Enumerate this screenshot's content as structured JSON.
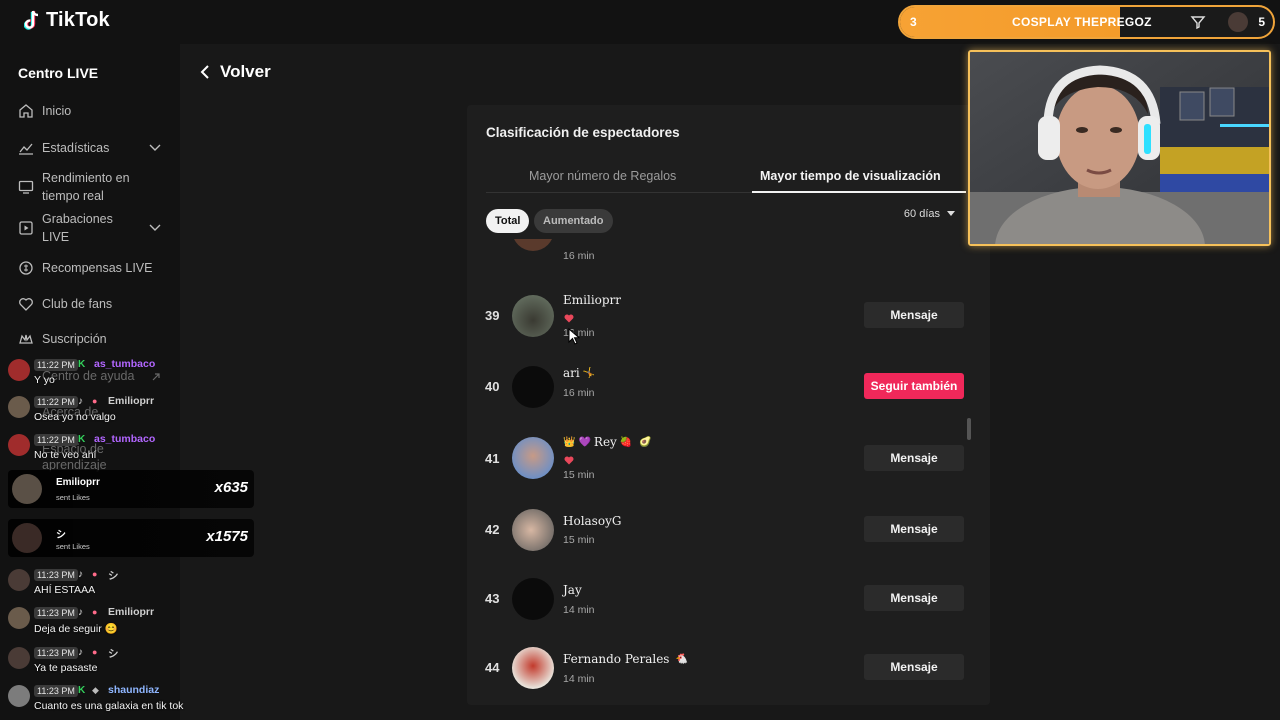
{
  "app": {
    "logo_text": "TikTok"
  },
  "goal": {
    "start": "3",
    "label": "COSPLAY THEPREGOZ",
    "end": "5",
    "progress": 0.59
  },
  "sidebar": {
    "title": "Centro LIVE",
    "items": [
      {
        "label": "Inicio",
        "icon": "home-icon"
      },
      {
        "label": "Estadísticas",
        "icon": "chart-icon"
      },
      {
        "label": "Rendimiento en tiempo real",
        "icon": "monitor-icon"
      },
      {
        "label": "Grabaciones LIVE",
        "icon": "recording-icon"
      },
      {
        "label": "Recompensas LIVE",
        "icon": "rewards-icon"
      },
      {
        "label": "Club de fans",
        "icon": "fans-icon"
      },
      {
        "label": "Suscripción",
        "icon": "subscription-icon"
      },
      {
        "label": "Centro de ayuda",
        "icon": "help-icon"
      },
      {
        "label": "Acerca de",
        "icon": "info-icon"
      },
      {
        "label": "Espacio de aprendizaje",
        "icon": "learn-icon"
      }
    ]
  },
  "main": {
    "back_label": "Volver",
    "panel_title": "Clasificación de espectadores",
    "tabs": [
      "Mayor número de Regalos",
      "Mayor tiempo de visualización"
    ],
    "filters": [
      "Total",
      "Aumentado"
    ],
    "period": "60 días",
    "partial_row": {
      "minutes": "16 min"
    },
    "rows": [
      {
        "rank": "39",
        "name": "Emilioprr",
        "heart": true,
        "minutes": "16 min",
        "action": "Mensaje"
      },
      {
        "rank": "40",
        "name": "ari",
        "heart": false,
        "minutes": "16 min",
        "action": "Seguir también"
      },
      {
        "rank": "41",
        "name": "Rey",
        "heart": true,
        "minutes": "15 min",
        "action": "Mensaje"
      },
      {
        "rank": "42",
        "name": "HolasoyG",
        "heart": false,
        "minutes": "15 min",
        "action": "Mensaje"
      },
      {
        "rank": "43",
        "name": "Jay",
        "heart": false,
        "minutes": "14 min",
        "action": "Mensaje"
      },
      {
        "rank": "44",
        "name": "Fernando Perales",
        "heart": false,
        "minutes": "14 min",
        "action": "Mensaje"
      }
    ]
  },
  "chat": {
    "messages": [
      {
        "time": "11:22 PM",
        "user": "as_tumbaco",
        "text": "Y yo"
      },
      {
        "time": "11:22 PM",
        "user": "Emilioprr",
        "text": "Osea yo no valgo"
      },
      {
        "time": "11:22 PM",
        "user": "as_tumbaco",
        "text": "No te veo ahí"
      },
      {
        "time": "11:23 PM",
        "user": "シ",
        "text": "AHÍ ESTAAA"
      },
      {
        "time": "11:23 PM",
        "user": "Emilioprr",
        "text": "Deja de seguir 😊"
      },
      {
        "time": "11:23 PM",
        "user": "シ",
        "text": "Ya te pasaste"
      },
      {
        "time": "11:23 PM",
        "user": "shaundiaz",
        "text": "Cuanto es una galaxia en tik tok"
      }
    ],
    "gifts": [
      {
        "user": "Emilioprr",
        "sub": "sent Likes",
        "count": "x635"
      },
      {
        "user": "シ",
        "sub": "sent Likes",
        "count": "x1575"
      }
    ]
  }
}
